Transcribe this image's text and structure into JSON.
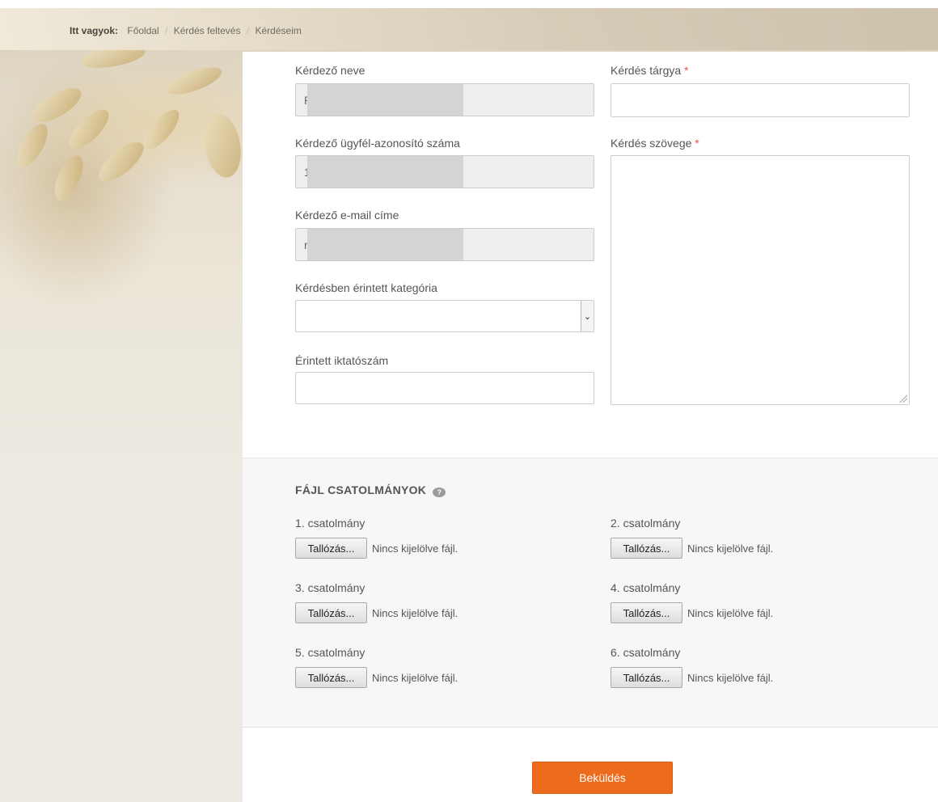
{
  "breadcrumb": {
    "lead": "Itt vagyok:",
    "items": [
      "Főoldal",
      "Kérdés feltevés",
      "Kérdéseim"
    ]
  },
  "form": {
    "asker_name": {
      "label": "Kérdező neve",
      "value": "R"
    },
    "asker_id": {
      "label": "Kérdező ügyfél-azonosító száma",
      "value": "1"
    },
    "asker_email": {
      "label": "Kérdező e-mail címe",
      "value": "r"
    },
    "category": {
      "label": "Kérdésben érintett kategória",
      "value": ""
    },
    "reference": {
      "label": "Érintett iktatószám",
      "value": ""
    },
    "subject": {
      "label": "Kérdés tárgya",
      "required_mark": "*",
      "value": ""
    },
    "body": {
      "label": "Kérdés szövege",
      "required_mark": "*",
      "value": ""
    }
  },
  "attachments": {
    "title": "FÁJL CSATOLMÁNYOK",
    "browse_label": "Tallózás...",
    "no_file_text": "Nincs kijelölve fájl.",
    "items": [
      {
        "label": "1. csatolmány"
      },
      {
        "label": "2. csatolmány"
      },
      {
        "label": "3. csatolmány"
      },
      {
        "label": "4. csatolmány"
      },
      {
        "label": "5. csatolmány"
      },
      {
        "label": "6. csatolmány"
      }
    ]
  },
  "submit_label": "Beküldés",
  "colors": {
    "accent": "#ed6b1d",
    "required": "#e0574f"
  }
}
